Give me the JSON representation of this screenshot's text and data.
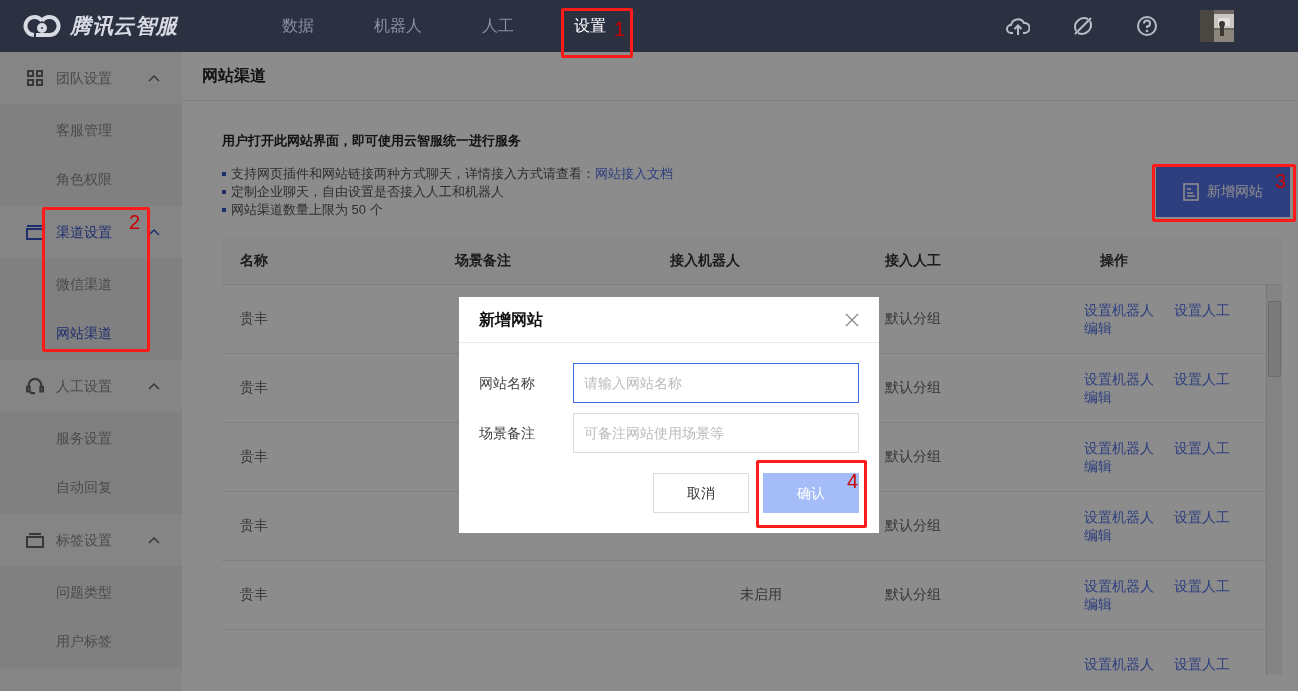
{
  "topbar": {
    "logo": "腾讯云智服",
    "nav": [
      {
        "label": "数据",
        "selected": false
      },
      {
        "label": "机器人",
        "selected": false
      },
      {
        "label": "人工",
        "selected": false
      },
      {
        "label": "设置",
        "selected": true
      }
    ]
  },
  "sidebar": {
    "groups": [
      {
        "label": "团队设置",
        "expanded": true,
        "selected": false,
        "children": [
          {
            "label": "客服管理",
            "selected": false
          },
          {
            "label": "角色权限",
            "selected": false
          }
        ]
      },
      {
        "label": "渠道设置",
        "expanded": true,
        "selected": true,
        "children": [
          {
            "label": "微信渠道",
            "selected": false
          },
          {
            "label": "网站渠道",
            "selected": true
          }
        ]
      },
      {
        "label": "人工设置",
        "expanded": true,
        "selected": false,
        "children": [
          {
            "label": "服务设置",
            "selected": false
          },
          {
            "label": "自动回复",
            "selected": false
          }
        ]
      },
      {
        "label": "标签设置",
        "expanded": true,
        "selected": false,
        "children": [
          {
            "label": "问题类型",
            "selected": false
          },
          {
            "label": "用户标签",
            "selected": false
          }
        ]
      }
    ]
  },
  "page": {
    "title": "网站渠道",
    "intro": "用户打开此网站界面，即可使用云智服统一进行服务",
    "notes": [
      {
        "text": "支持网页插件和网站链接两种方式聊天，详情接入方式请查看：",
        "link": "网站接入文档"
      },
      {
        "text": "定制企业聊天，自由设置是否接入人工和机器人"
      },
      {
        "text": "网站渠道数量上限为 50 个"
      }
    ],
    "add_button": "新增网站"
  },
  "table": {
    "columns": [
      "名称",
      "场景备注",
      "接入机器人",
      "接入人工",
      "操作"
    ],
    "rows": [
      {
        "name": "贵丰",
        "agent": "默认分组",
        "actions": [
          "设置机器人",
          "设置人工",
          "编辑"
        ]
      },
      {
        "name": "贵丰",
        "agent": "默认分组",
        "actions": [
          "设置机器人",
          "设置人工",
          "编辑"
        ]
      },
      {
        "name": "贵丰",
        "agent": "默认分组",
        "actions": [
          "设置机器人",
          "设置人工",
          "编辑"
        ]
      },
      {
        "name": "贵丰",
        "agent": "默认分组",
        "actions": [
          "设置机器人",
          "设置人工",
          "编辑"
        ]
      },
      {
        "name": "贵丰",
        "robot": "未启用",
        "agent": "默认分组",
        "actions": [
          "设置机器人",
          "设置人工",
          "编辑"
        ]
      },
      {
        "actions": [
          "设置机器人",
          "设置人工"
        ]
      }
    ]
  },
  "dialog": {
    "title": "新增网站",
    "fields": [
      {
        "label": "网站名称",
        "placeholder": "请输入网站名称",
        "focused": true
      },
      {
        "label": "场景备注",
        "placeholder": "可备注网站使用场景等",
        "focused": false
      }
    ],
    "buttons": [
      {
        "label": "取消",
        "kind": "secondary",
        "disabled": false
      },
      {
        "label": "确认",
        "kind": "primary",
        "disabled": true
      }
    ]
  },
  "annotations": [
    {
      "number": "1"
    },
    {
      "number": "2"
    },
    {
      "number": "3"
    },
    {
      "number": "4"
    }
  ]
}
